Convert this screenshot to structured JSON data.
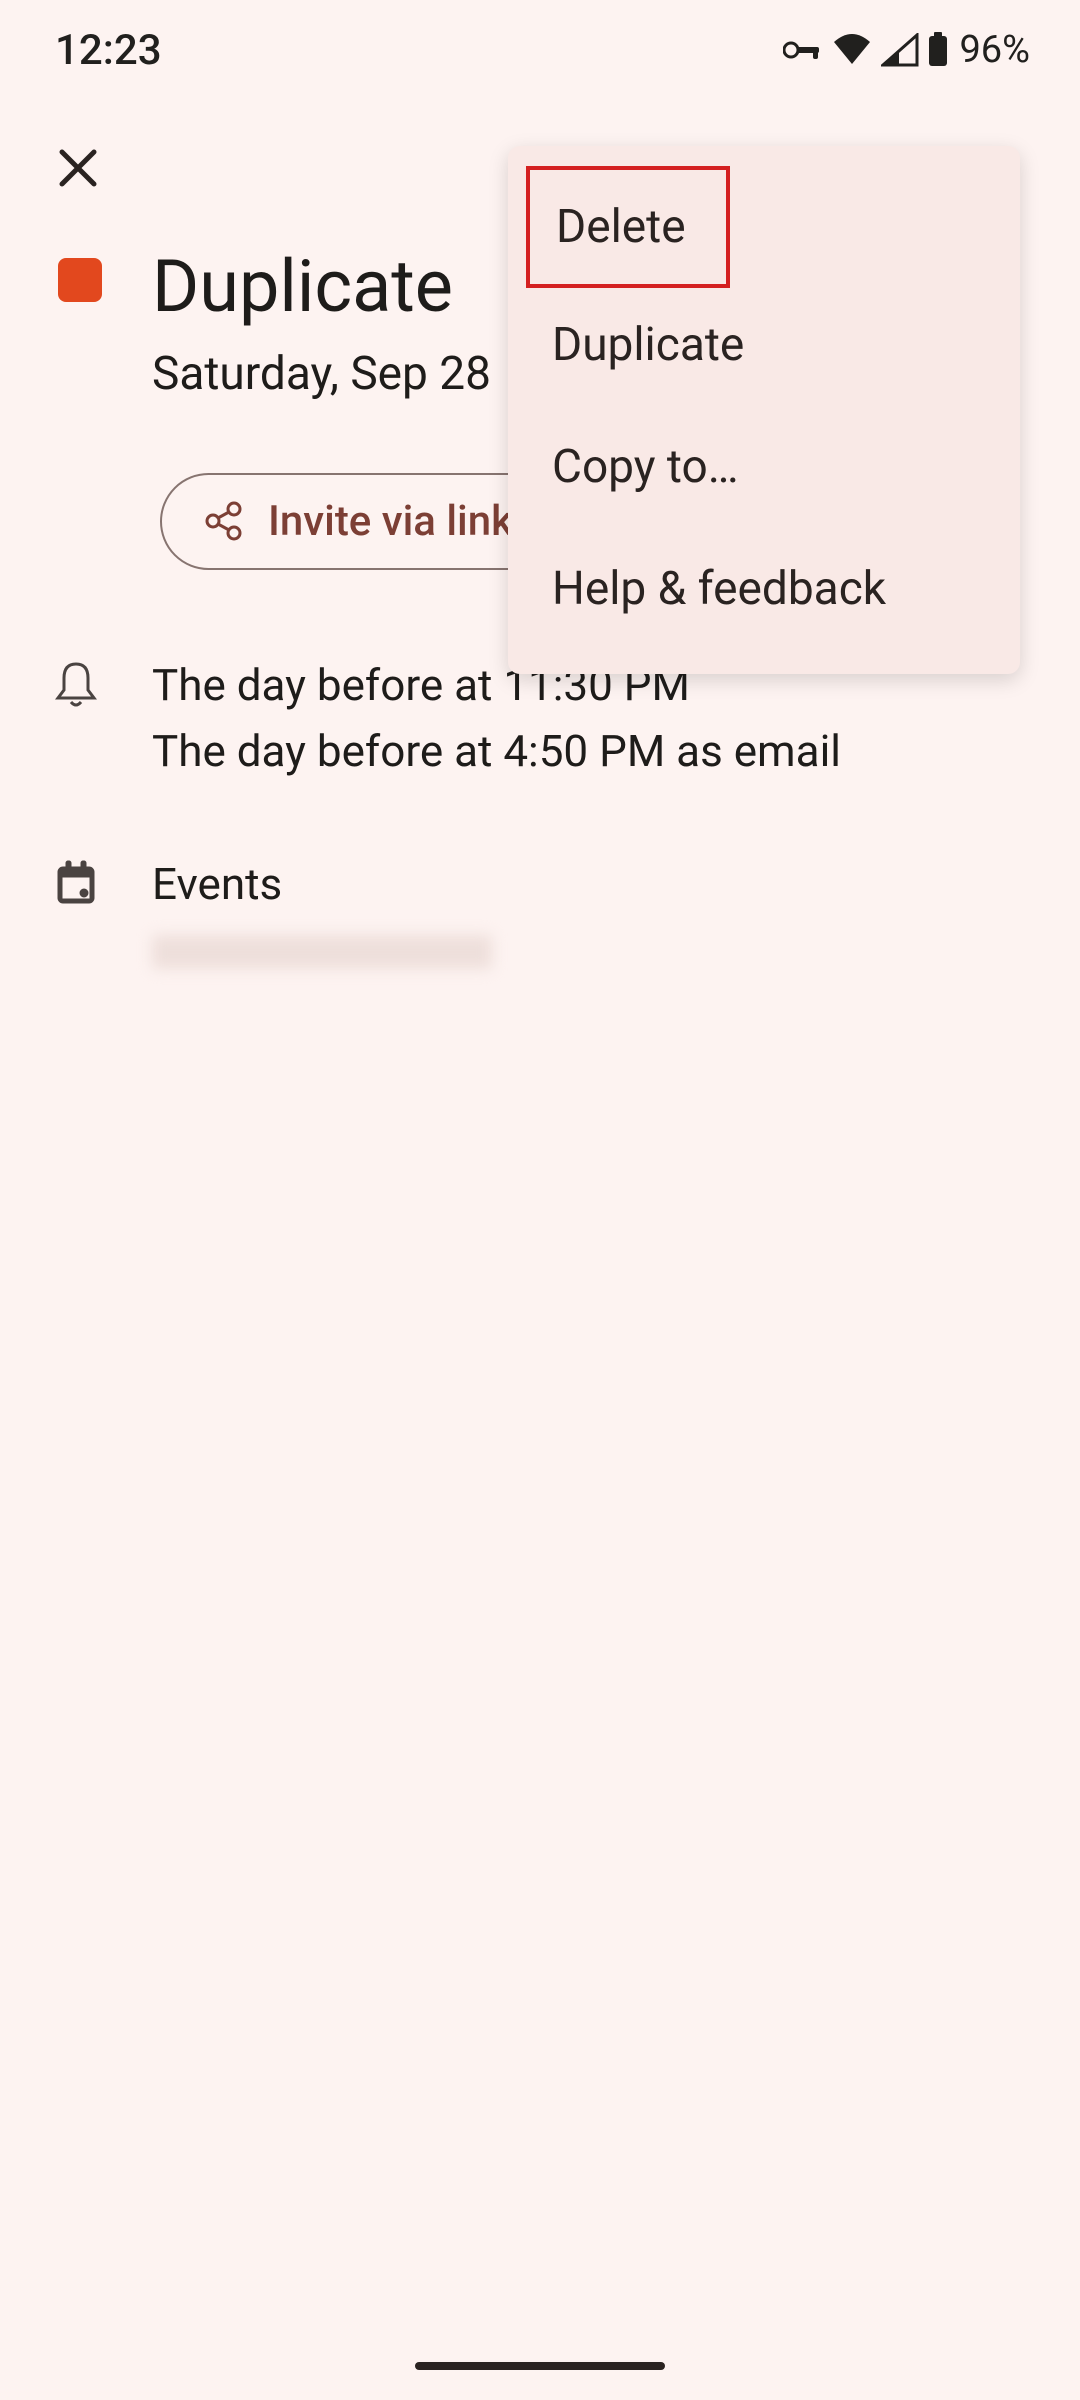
{
  "status": {
    "time": "12:23",
    "battery": "96%"
  },
  "event": {
    "title": "Duplicate",
    "date": "Saturday, Sep 28",
    "color": "#e2481e"
  },
  "invite": {
    "label": "Invite via link"
  },
  "notifications": {
    "line1": "The day before at 11:30 PM",
    "line2": "The day before at 4:50 PM as email"
  },
  "calendar": {
    "name": "Events"
  },
  "menu": {
    "items": [
      {
        "label": "Delete",
        "highlighted": true
      },
      {
        "label": "Duplicate",
        "highlighted": false
      },
      {
        "label": "Copy to…",
        "highlighted": false
      },
      {
        "label": "Help & feedback",
        "highlighted": false
      }
    ]
  }
}
